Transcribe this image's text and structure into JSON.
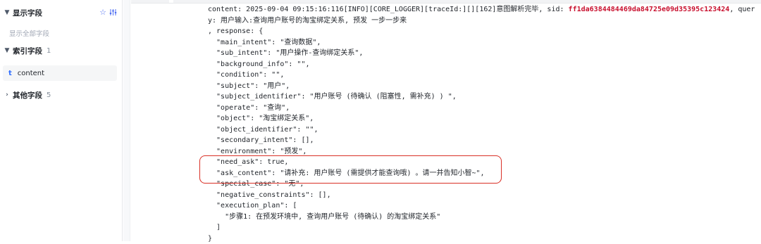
{
  "sidebar": {
    "display_fields": {
      "label": "显示字段"
    },
    "show_all_hint": "显示全部字段",
    "index_fields": {
      "label": "索引字段",
      "count": "1"
    },
    "fields": [
      {
        "type": "t",
        "name": "content"
      }
    ],
    "other_fields": {
      "label": "其他字段",
      "count": "5"
    },
    "icons": {
      "star": "star-icon",
      "filter": "filter-settings-icon"
    }
  },
  "log": {
    "line1_prefix": "content: 2025-09-04 09:15:16:116[INFO][CORE_LOGGER][traceId:][][162]意图解析完毕, sid: ",
    "sid": "ff1da6384484469da84725e09d35395c123424",
    "line1_suffix": ", quer",
    "lines": [
      "y: 用户输入:查询用户账号的淘宝绑定关系, 预发 一步一步来",
      ", response: {",
      "  \"main_intent\": \"查询数据\",",
      "  \"sub_intent\": \"用户操作-查询绑定关系\",",
      "  \"background_info\": \"\",",
      "  \"condition\": \"\",",
      "  \"subject\": \"用户\",",
      "  \"subject_identifier\": \"用户账号 (待确认 (阻塞性, 需补充) ) \",",
      "  \"operate\": \"查询\",",
      "  \"object\": \"淘宝绑定关系\",",
      "  \"object_identifier\": \"\",",
      "  \"secondary_intent\": [],",
      "  \"environment\": \"预发\",",
      "  \"need_ask\": true,",
      "  \"ask_content\": \"请补充: 用户账号 (需提供才能查询哦) 。请一并告知小智~\",",
      "  \"special_case\": \"无\",",
      "  \"negative_constraints\": [],",
      "  \"execution_plan\": [",
      "    \"步骤1: 在预发环境中, 查询用户账号 (待确认) 的淘宝绑定关系\"",
      "  ]",
      "}"
    ]
  }
}
